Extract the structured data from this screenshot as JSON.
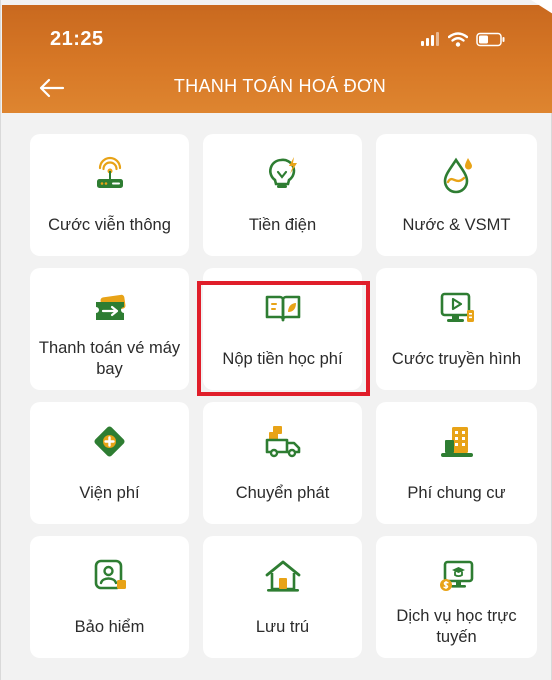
{
  "status_bar": {
    "time": "21:25",
    "icons": [
      "signal-icon",
      "wifi-icon",
      "battery-icon"
    ]
  },
  "nav": {
    "title": "THANH TOÁN HOÁ ĐƠN",
    "back_icon": "back-arrow-icon"
  },
  "colors": {
    "header": "#d77826",
    "accent_green": "#2e7d32",
    "accent_gold": "#e8a317",
    "highlight": "#e01e2a"
  },
  "services": [
    {
      "label": "Cước viễn thông",
      "icon": "router-icon"
    },
    {
      "label": "Tiền điện",
      "icon": "lightbulb-icon"
    },
    {
      "label": "Nước & VSMT",
      "icon": "water-drop-icon"
    },
    {
      "label": "Thanh toán vé máy bay",
      "icon": "plane-ticket-icon"
    },
    {
      "label": "Nộp tiền học phí",
      "icon": "open-book-icon"
    },
    {
      "label": "Cước truyền hình",
      "icon": "tv-monitor-icon"
    },
    {
      "label": "Viện phí",
      "icon": "medical-cross-icon"
    },
    {
      "label": "Chuyển phát",
      "icon": "delivery-truck-icon"
    },
    {
      "label": "Phí chung cư",
      "icon": "apartment-building-icon"
    },
    {
      "label": "Bảo hiểm",
      "icon": "insurance-person-icon"
    },
    {
      "label": "Lưu trú",
      "icon": "house-icon"
    },
    {
      "label": "Dịch vụ học trực tuyến",
      "icon": "online-learning-icon"
    }
  ]
}
